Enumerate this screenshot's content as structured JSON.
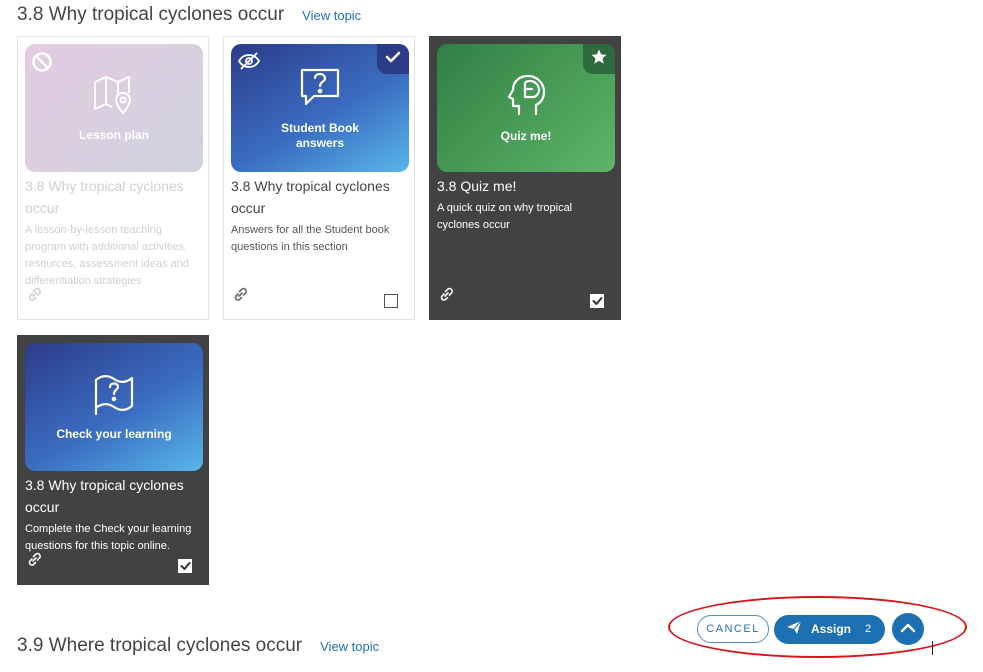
{
  "sections": [
    {
      "title": "3.8 Why tropical cyclones occur",
      "view_link": "View topic"
    },
    {
      "title": "3.9 Where tropical cyclones occur",
      "view_link": "View topic"
    }
  ],
  "cards": [
    {
      "tile_label": "Lesson plan",
      "title": "3.8 Why tropical cyclones occur",
      "description": "A lesson-by-lesson teaching program with additional activities, resources, assessment ideas and differentiation strategies",
      "state": "disabled",
      "checked": false
    },
    {
      "tile_label": "Student Book answers",
      "title": "3.8 Why tropical cyclones occur",
      "description": "Answers for all the Student book questions in this section",
      "state": "hidden-from-students",
      "checked": false
    },
    {
      "tile_label": "Quiz me!",
      "title": "3.8 Quiz me!",
      "description": "A quick quiz on why tropical cyclones occur",
      "state": "selected",
      "checked": true
    },
    {
      "tile_label": "Check your learning",
      "title": "3.8 Why tropical cyclones occur",
      "description": "Complete the Check your learning questions for this topic online.",
      "state": "selected",
      "checked": true
    }
  ],
  "actions": {
    "cancel_label": "CANCEL",
    "assign_label": "Assign",
    "assign_count": "2"
  },
  "colors": {
    "primary": "#1c6fb0",
    "dark_card": "#424242",
    "highlight": "#d8151b"
  }
}
